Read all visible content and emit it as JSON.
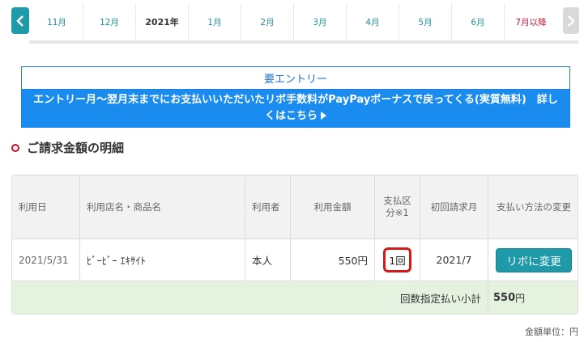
{
  "month_nav": {
    "months": [
      {
        "label": "11月",
        "style": "link"
      },
      {
        "label": "12月",
        "style": "link"
      },
      {
        "label": "2021年",
        "style": "bold"
      },
      {
        "label": "1月",
        "style": "link"
      },
      {
        "label": "2月",
        "style": "link"
      },
      {
        "label": "3月",
        "style": "link"
      },
      {
        "label": "4月",
        "style": "link"
      },
      {
        "label": "5月",
        "style": "link"
      },
      {
        "label": "6月",
        "style": "link"
      },
      {
        "label": "7月以降",
        "style": "active"
      }
    ],
    "prev_icon": "chevron-left-icon",
    "next_icon": "chevron-right-icon"
  },
  "banner": {
    "header": "要エントリー",
    "body": "エントリー月～翌月末までにお支払いいただいたリボ手数料がPayPayボーナスで戻ってくる(実質無料)　詳しくはこちら"
  },
  "section": {
    "title": "ご請求金額の明細"
  },
  "table": {
    "headers": {
      "date": "利用日",
      "store": "利用店名・商品名",
      "user": "利用者",
      "amount": "利用金額",
      "payment_type": "支払区分※1",
      "first_billing": "初回請求月",
      "change_method": "支払い方法の変更"
    },
    "rows": [
      {
        "date": "2021/5/31",
        "store": "ﾋﾞｰﾋﾞｰ ｴｷｻｲﾄ",
        "user": "本人",
        "amount": "550円",
        "payment_type": "1回",
        "first_billing": "2021/7",
        "action_label": "リボに変更"
      }
    ],
    "subtotal_label": "回数指定払い小計",
    "subtotal_value": "550",
    "subtotal_unit": "円"
  },
  "unit_note": "金額単位：円",
  "colors": {
    "accent_teal": "#1f9aa8",
    "active_red": "#c8102e",
    "banner_blue": "#1a8cf0",
    "highlight_red": "#d11a1a",
    "subtotal_green": "#e5f2df"
  }
}
